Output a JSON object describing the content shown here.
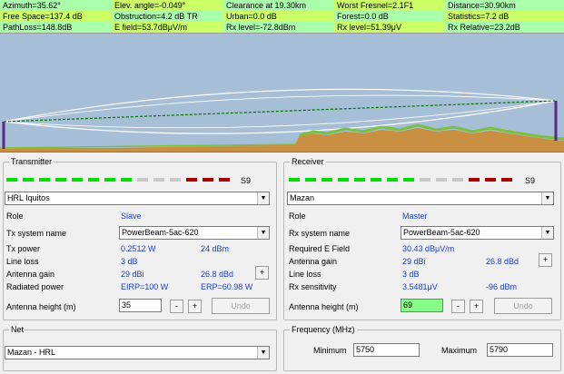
{
  "stats": {
    "row1": [
      "Azimuth=35.62°",
      "Elev. angle=-0.049°",
      "Clearance at 19.30km",
      "Worst Fresnel=2.1F1",
      "Distance=30.90km"
    ],
    "row2": [
      "Free Space=137.4 dB",
      "Obstruction=4.2 dB TR",
      "Urban=0.0 dB",
      "Forest=0.0 dB",
      "Statistics=7.2 dB"
    ],
    "row3": [
      "PathLoss=148.8dB",
      "E field=53.7dBμV/m",
      "Rx level=-72.8dBm",
      "Rx level=51.39μV",
      "Rx Relative=23.2dB"
    ]
  },
  "transmitter": {
    "title": "Transmitter",
    "s_meter_label": "S9",
    "s_meter_level": 0.58,
    "site": "HRL Iquitos",
    "role_label": "Role",
    "role_value": "Slave",
    "system_label": "Tx system name",
    "system_value": "PowerBeam-5ac-620",
    "power_label": "Tx power",
    "power_w": "0.2512 W",
    "power_dbm": "24 dBm",
    "line_loss_label": "Line loss",
    "line_loss": "3 dB",
    "gain_label": "Antenna gain",
    "gain_dbi": "29 dBi",
    "gain_dbd": "26.8 dBd",
    "radiated_label": "Radiated power",
    "eirp": "EIRP=100 W",
    "erp": "ERP=60.98 W",
    "height_label": "Antenna height (m)",
    "height_value": "35",
    "minus": "-",
    "plus": "+",
    "undo": "Undo"
  },
  "receiver": {
    "title": "Receiver",
    "s_meter_label": "S9",
    "s_meter_level": 0.58,
    "site": "Mazan",
    "role_label": "Role",
    "role_value": "Master",
    "system_label": "Rx system name",
    "system_value": "PowerBeam-5ac-620",
    "field_label": "Required E Field",
    "field_value": "30.43 dBμV/m",
    "gain_label": "Antenna gain",
    "gain_dbi": "29 dBi",
    "gain_dbd": "26.8 dBd",
    "line_loss_label": "Line loss",
    "line_loss": "3 dB",
    "sens_label": "Rx sensitivity",
    "sens_uv": "3.5481μV",
    "sens_dbm": "-96 dBm",
    "height_label": "Antenna height (m)",
    "height_value": "69",
    "minus": "-",
    "plus": "+",
    "undo": "Undo"
  },
  "net": {
    "title": "Net",
    "value": "Mazan - HRL"
  },
  "frequency": {
    "title": "Frequency (MHz)",
    "min_label": "Minimum",
    "min_value": "5750",
    "max_label": "Maximum",
    "max_value": "5790"
  },
  "colors": {
    "meter_green": "#00dd00",
    "meter_red": "#a80000",
    "meter_grey": "#c8c8c8",
    "terrain": "#c89040",
    "vegetation": "#7ac043",
    "los_line": "#007000",
    "sky": "#a7bfd6",
    "required_field": "#1a3fd1"
  }
}
